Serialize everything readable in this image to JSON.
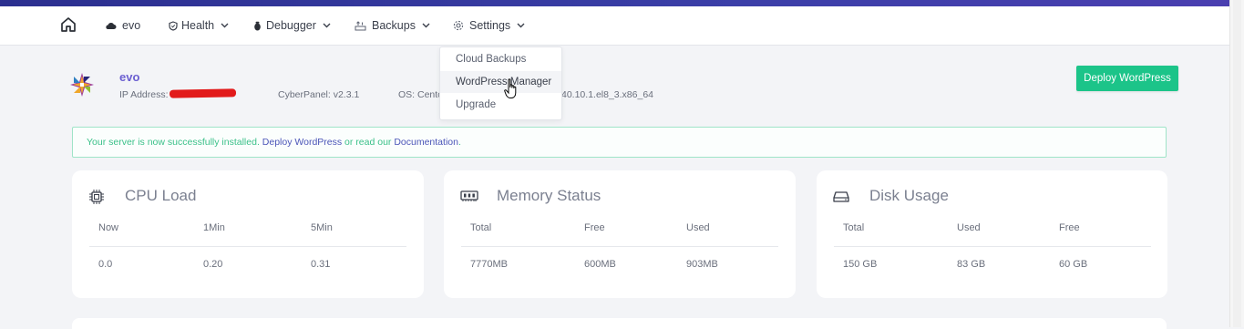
{
  "nav": {
    "home_icon": "home-icon",
    "items": [
      {
        "label": "evo",
        "icon": "cloud-icon"
      },
      {
        "label": "Health",
        "icon": "shield-icon"
      },
      {
        "label": "Debugger",
        "icon": "bug-icon"
      },
      {
        "label": "Backups",
        "icon": "backup-icon"
      },
      {
        "label": "Settings",
        "icon": "gear-icon"
      }
    ]
  },
  "settings_dropdown": {
    "items": [
      {
        "label": "Cloud Backups"
      },
      {
        "label": "WordPress Manager",
        "hovered": true
      },
      {
        "label": "Upgrade"
      }
    ]
  },
  "server": {
    "name": "evo",
    "ip_label": "IP Address: 1",
    "cyberpanel": "CyberPanel: v2.3.1",
    "os_label": "OS: Cento",
    "os_tail": "40.10.1.el8_3.x86_64"
  },
  "deploy_button": "Deploy WordPress",
  "alert": {
    "prefix": "Your server is now successfully installed. ",
    "link1": "Deploy WordPress",
    "middle": " or read our ",
    "link2": "Documentation",
    "suffix": "."
  },
  "cards": {
    "cpu": {
      "title": "CPU Load",
      "headers": [
        "Now",
        "1Min",
        "5Min"
      ],
      "values": [
        "0.0",
        "0.20",
        "0.31"
      ]
    },
    "memory": {
      "title": "Memory Status",
      "headers": [
        "Total",
        "Free",
        "Used"
      ],
      "values": [
        "7770MB",
        "600MB",
        "903MB"
      ]
    },
    "disk": {
      "title": "Disk Usage",
      "headers": [
        "Total",
        "Used",
        "Free"
      ],
      "values": [
        "150 GB",
        "83 GB",
        "60 GB"
      ]
    }
  },
  "colors": {
    "accent": "#1cc489",
    "brand_purple": "#6b5fd1",
    "link": "#4b55b8",
    "alert_green": "#3cc18a"
  }
}
